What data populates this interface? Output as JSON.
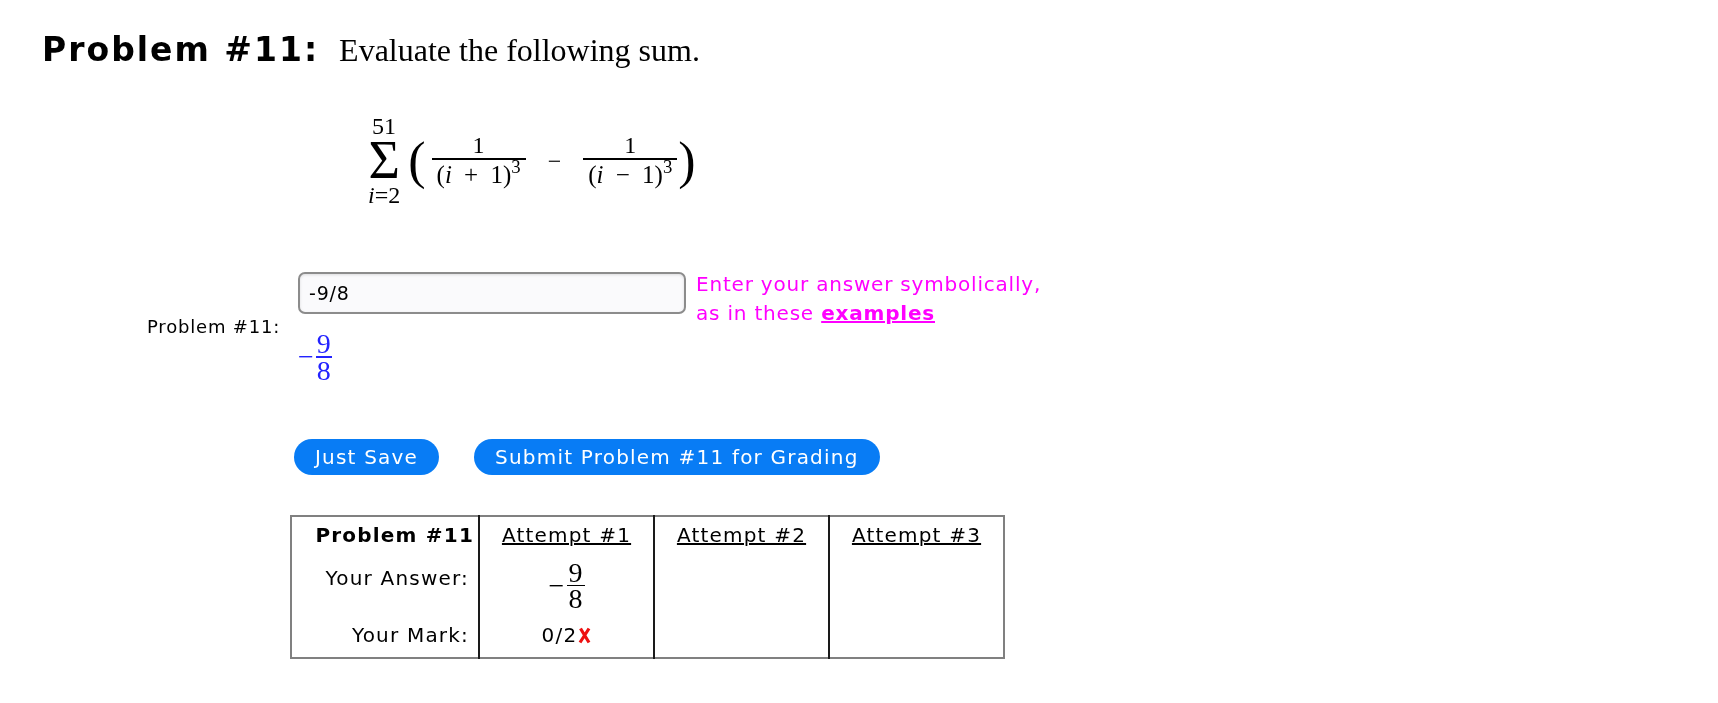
{
  "problem": {
    "title": "Problem #11:",
    "statement": "Evaluate the following sum."
  },
  "formula": {
    "operator": "Σ",
    "upper": "51",
    "lower": "*i*=2",
    "left_paren": "(",
    "right_paren": ")",
    "operation": "−",
    "terms": [
      {
        "numerator": "1",
        "denominator": "(*i* + 1)$^{3}$"
      },
      {
        "numerator": "1",
        "denominator": "(*i* − 1)$^{3}$"
      }
    ]
  },
  "answer": {
    "label": "Problem #11:",
    "value": "-9/8",
    "hint": "Enter your answer symbolically, as in these",
    "hint_link": "examples",
    "preview": {
      "sign": "−",
      "numerator": "9",
      "denominator": "8"
    }
  },
  "buttons": [
    "Just Save",
    "Submit Problem #11 for Grading"
  ],
  "attempts_table": {
    "title": "Problem #11",
    "columns": [
      "Attempt #1",
      "Attempt #2",
      "Attempt #3"
    ],
    "answer_label": "Your Answer:",
    "mark_label": "Your Mark:",
    "attempts": [
      {
        "answer": {
          "sign": "−",
          "numerator": "9",
          "denominator": "8"
        },
        "mark": "0/2",
        "correct": false
      }
    ]
  }
}
